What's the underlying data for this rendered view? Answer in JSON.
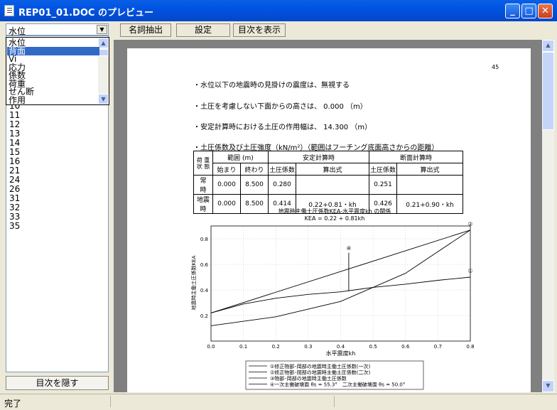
{
  "window": {
    "title": "REP01_01.DOC のプレビュー",
    "minimize": "_",
    "maximize": "□",
    "close": "✕"
  },
  "toc": {
    "combo_value": "水位",
    "dropdown_items": [
      "水位",
      "背面",
      "Vi",
      "応力",
      "係数",
      "荷重",
      "せん断",
      "作用"
    ],
    "selected_index": 1,
    "list_items": [
      "10",
      "11",
      "12",
      "13",
      "14",
      "15",
      "16",
      "21",
      "24",
      "26",
      "31",
      "32",
      "33",
      "35"
    ],
    "hide_button": "目次を隠す"
  },
  "toolbar": {
    "extract": "名詞抽出",
    "settings": "設定",
    "show_toc": "目次を表示"
  },
  "status": {
    "text": "完了"
  },
  "document": {
    "page_number": "45",
    "line1": "・水位以下の地震時の見掛けの震度は、無視する",
    "line2": "・土圧を考慮しない下面からの高さは、 0.000 （m）",
    "line3": "・安定計算時における土圧の作用幅は、 14.300 （m）",
    "line4": "・土圧係数及び土圧強度（kN/m²）（範囲はフーチング底面高さからの距離）",
    "table": {
      "h_state": "荷 重 状 態",
      "h_range": "範囲 (m)",
      "h_stable": "安定計算時",
      "h_section": "断面計算時",
      "h_start": "始まり",
      "h_end": "終わり",
      "h_coef": "土圧係数",
      "h_formula": "算出式",
      "rows": [
        {
          "state": "常　時",
          "start": "0.000",
          "end": "8.500",
          "k1": "0.280",
          "f1": "",
          "k2": "0.251",
          "f2": ""
        },
        {
          "state": "地震時",
          "start": "0.000",
          "end": "8.500",
          "k1": "0.414",
          "f1": "0.22+0.81・kh",
          "k2": "0.426",
          "f2": "0.21+0.90・kh"
        }
      ]
    }
  },
  "chart_data": {
    "type": "line",
    "title": "地震時主働土圧係数KEA-水平震度kh の関係",
    "subtitle": "KEA = 0.22 + 0.81kh",
    "xlabel": "水平震度kh",
    "ylabel": "地震時主働土圧係数KEA",
    "xlim": [
      0.0,
      0.8
    ],
    "ylim": [
      0.0,
      0.9
    ],
    "x_ticks": [
      "0.0",
      "0.1",
      "0.2",
      "0.3",
      "0.4",
      "0.5",
      "0.6",
      "0.7",
      "0.8"
    ],
    "y_ticks": [
      "0.2",
      "0.4",
      "0.6",
      "0.8"
    ],
    "grid": true,
    "markers": [
      "①",
      "②",
      "③",
      "④"
    ],
    "series": [
      {
        "name": "①修正物部･岡部の地震時主働土圧係数(一次)",
        "x": [
          0.0,
          0.8
        ],
        "y": [
          0.22,
          0.868
        ]
      },
      {
        "name": "②修正物部･岡部の地震時主働土圧係数(二次)",
        "x": [
          0.0,
          0.2,
          0.4,
          0.6,
          0.8
        ],
        "y": [
          0.12,
          0.19,
          0.31,
          0.53,
          0.868
        ]
      },
      {
        "name": "③物部･岡部の地震時主働土圧係数",
        "x": [
          0.0,
          0.1,
          0.2,
          0.3,
          0.4,
          0.5,
          0.6,
          0.7,
          0.8
        ],
        "y": [
          0.22,
          0.29,
          0.335,
          0.365,
          0.385,
          0.42,
          0.445,
          0.475,
          0.5
        ]
      },
      {
        "name": "④一次主働破壊面 θs = 55.3°　二次主働破壊面 θs = 50.0°",
        "x": [
          0.425,
          0.425
        ],
        "y": [
          0.39,
          0.69
        ]
      }
    ]
  }
}
